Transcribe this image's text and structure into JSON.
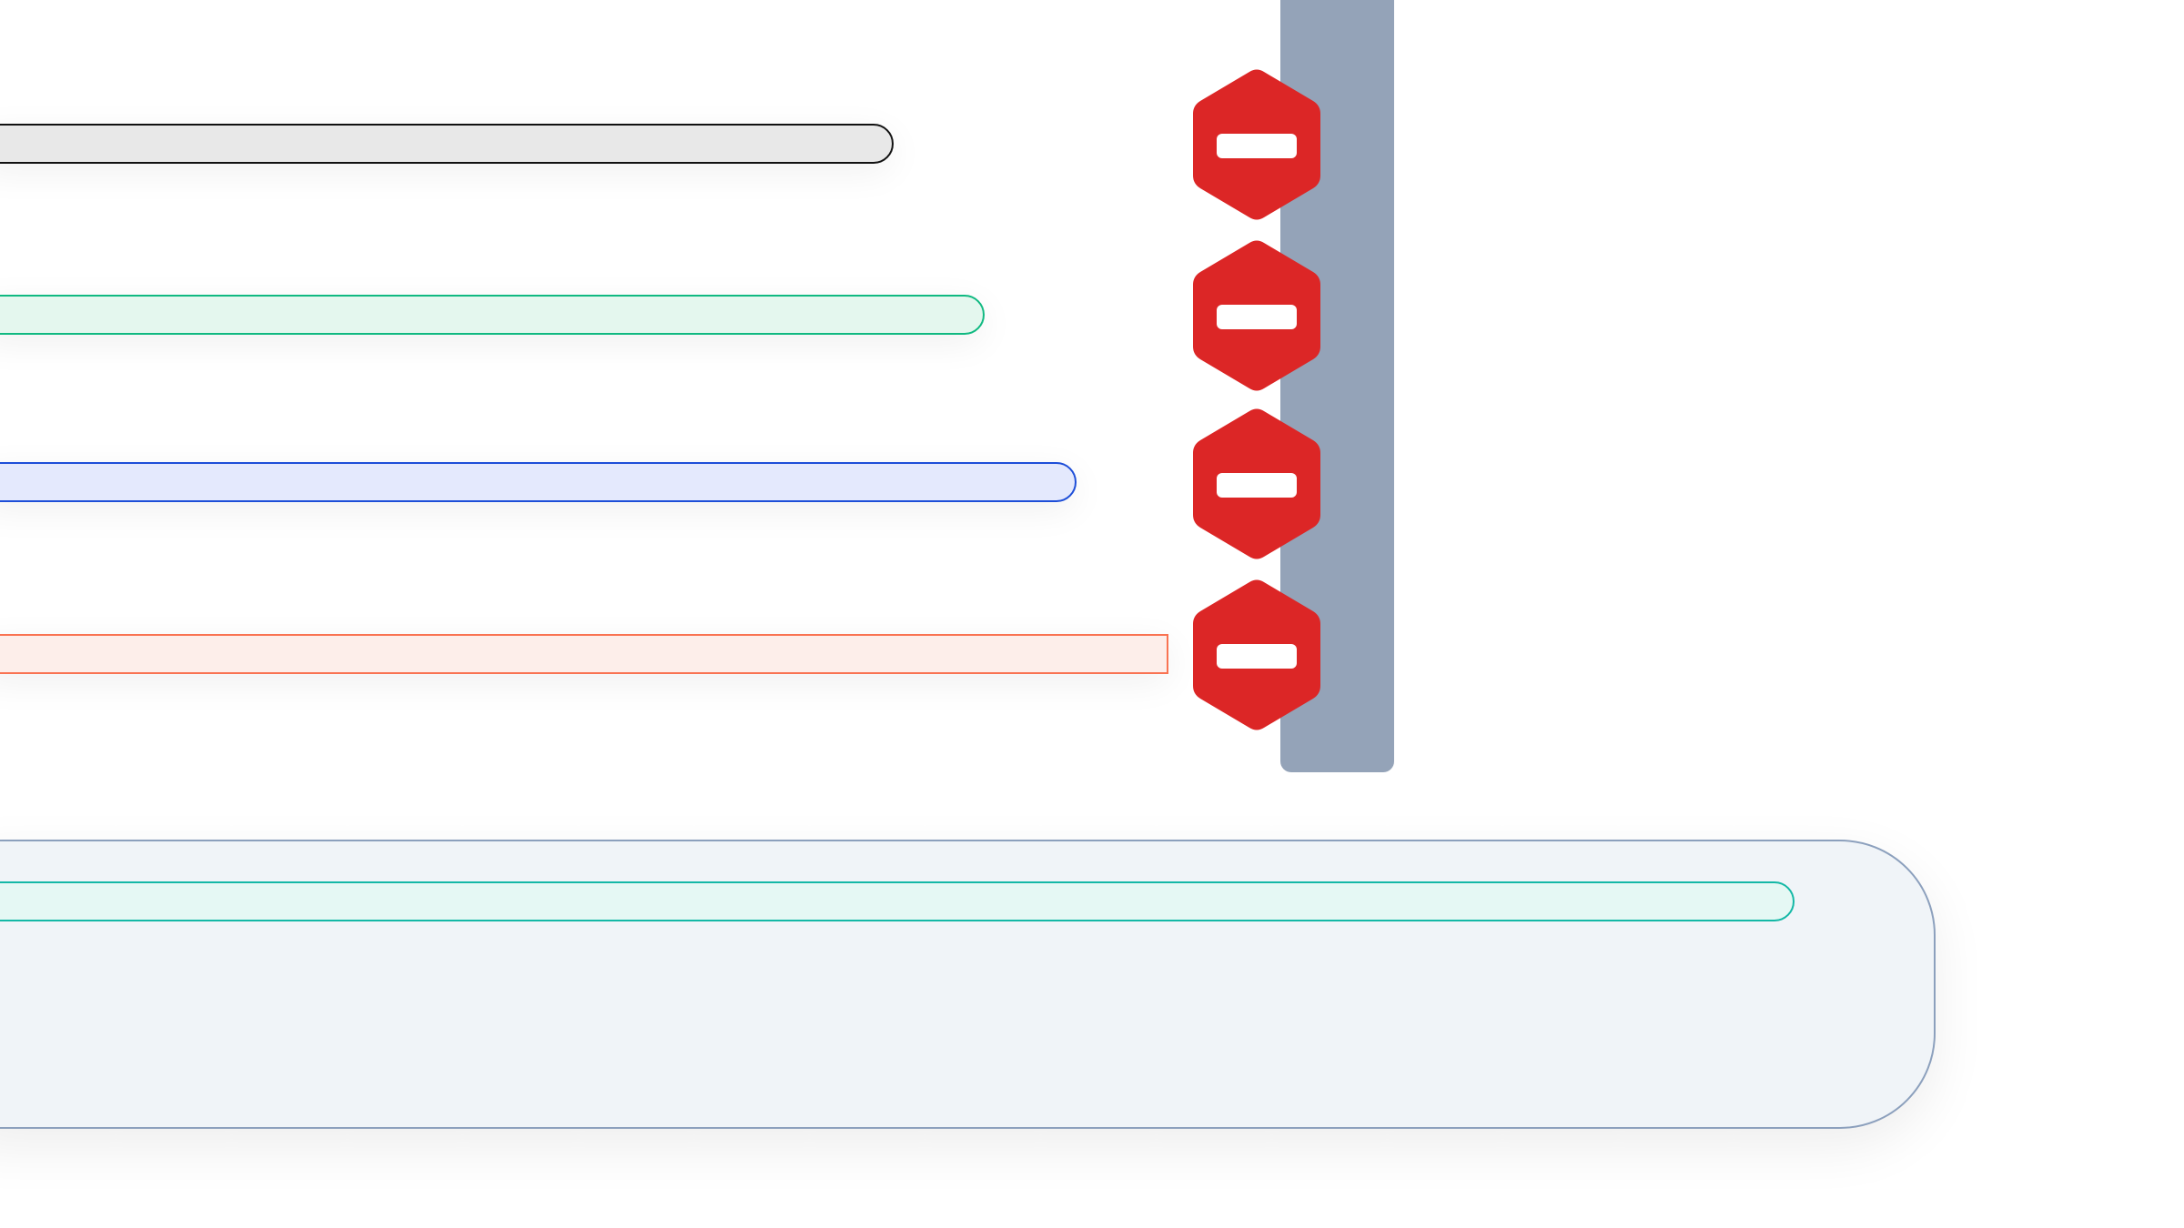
{
  "colors": {
    "background": "#ffffff",
    "rail": "#94a3b8",
    "stop_fill": "#dc2626",
    "stop_bar": "#ffffff",
    "bars": [
      {
        "fill": "#e8e8e8",
        "border": "#111111"
      },
      {
        "fill": "#e4f7ee",
        "border": "#10b981"
      },
      {
        "fill": "#e4e9fd",
        "border": "#1d4ed8"
      },
      {
        "fill": "#fdeeea",
        "border": "#f97352"
      }
    ],
    "panel": {
      "fill": "#f0f4f8",
      "border": "#8ca0bd"
    },
    "panel_bar": {
      "fill": "#e5f8f4",
      "border": "#14b8a6"
    }
  },
  "icons": [
    "stop-icon",
    "stop-icon",
    "stop-icon",
    "stop-icon"
  ]
}
